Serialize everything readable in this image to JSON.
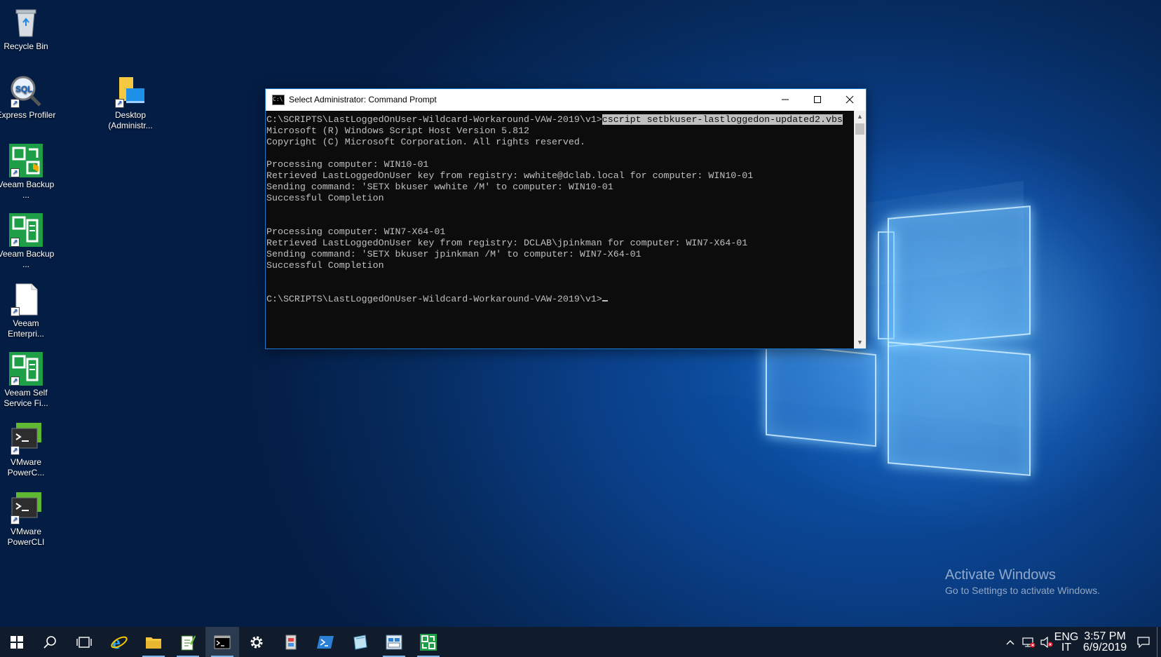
{
  "desktop": {
    "icons": [
      {
        "label": "Recycle Bin",
        "icon": "recycle-bin-icon"
      },
      {
        "label": "Express Profiler",
        "icon": "sql-profiler-icon"
      },
      {
        "label": "Desktop (Administr...",
        "icon": "folder-icon"
      },
      {
        "label": "Veeam Backup ...",
        "icon": "veeam-backup-icon"
      },
      {
        "label": "Veeam Backup ...",
        "icon": "veeam-backup-icon"
      },
      {
        "label": "Veeam Enterpri...",
        "icon": "document-icon"
      },
      {
        "label": "Veeam Self Service Fi...",
        "icon": "veeam-self-service-icon"
      },
      {
        "label": "VMware PowerC...",
        "icon": "powercli-icon"
      },
      {
        "label": "VMware PowerCLI",
        "icon": "powercli-icon"
      }
    ]
  },
  "cmd": {
    "title": "Select Administrator: Command Prompt",
    "prompt": "C:\\SCRIPTS\\LastLoggedOnUser-Wildcard-Workaround-VAW-2019\\v1>",
    "selected_command": "cscript setbkuser-lastloggedon-updated2.vbs",
    "output": "Microsoft (R) Windows Script Host Version 5.812\nCopyright (C) Microsoft Corporation. All rights reserved.\n\nProcessing computer: WIN10-01\nRetrieved LastLoggedOnUser key from registry: wwhite@dclab.local for computer: WIN10-01\nSending command: 'SETX bkuser wwhite /M' to computer: WIN10-01\nSuccessful Completion\n\n\nProcessing computer: WIN7-X64-01\nRetrieved LastLoggedOnUser key from registry: DCLAB\\jpinkman for computer: WIN7-X64-01\nSending command: 'SETX bkuser jpinkman /M' to computer: WIN7-X64-01\nSuccessful Completion\n\n\n",
    "final_prompt": "C:\\SCRIPTS\\LastLoggedOnUser-Wildcard-Workaround-VAW-2019\\v1>"
  },
  "watermark": {
    "line1": "Activate Windows",
    "line2": "Go to Settings to activate Windows."
  },
  "taskbar": {
    "apps": [
      {
        "name": "internet-explorer",
        "icon": "internet-explorer-icon"
      },
      {
        "name": "file-explorer",
        "icon": "folder-icon"
      },
      {
        "name": "notepad-plus",
        "icon": "notepad-icon"
      },
      {
        "name": "command-prompt",
        "icon": "command-prompt-icon"
      },
      {
        "name": "settings",
        "icon": "gear-icon"
      },
      {
        "name": "app-6",
        "icon": "app-icon"
      },
      {
        "name": "powershell",
        "icon": "powershell-icon"
      },
      {
        "name": "app-8",
        "icon": "app-icon"
      },
      {
        "name": "app-9",
        "icon": "app-icon"
      },
      {
        "name": "veeam",
        "icon": "veeam-icon"
      }
    ],
    "lang_top": "ENG",
    "lang_bottom": "IT",
    "time": "3:57 PM",
    "date": "6/9/2019"
  },
  "colors": {
    "console_bg": "#0c0c0c",
    "console_fg": "#c0c0c0",
    "taskbar": "#101c2c",
    "veeam_green": "#1f9e48"
  }
}
